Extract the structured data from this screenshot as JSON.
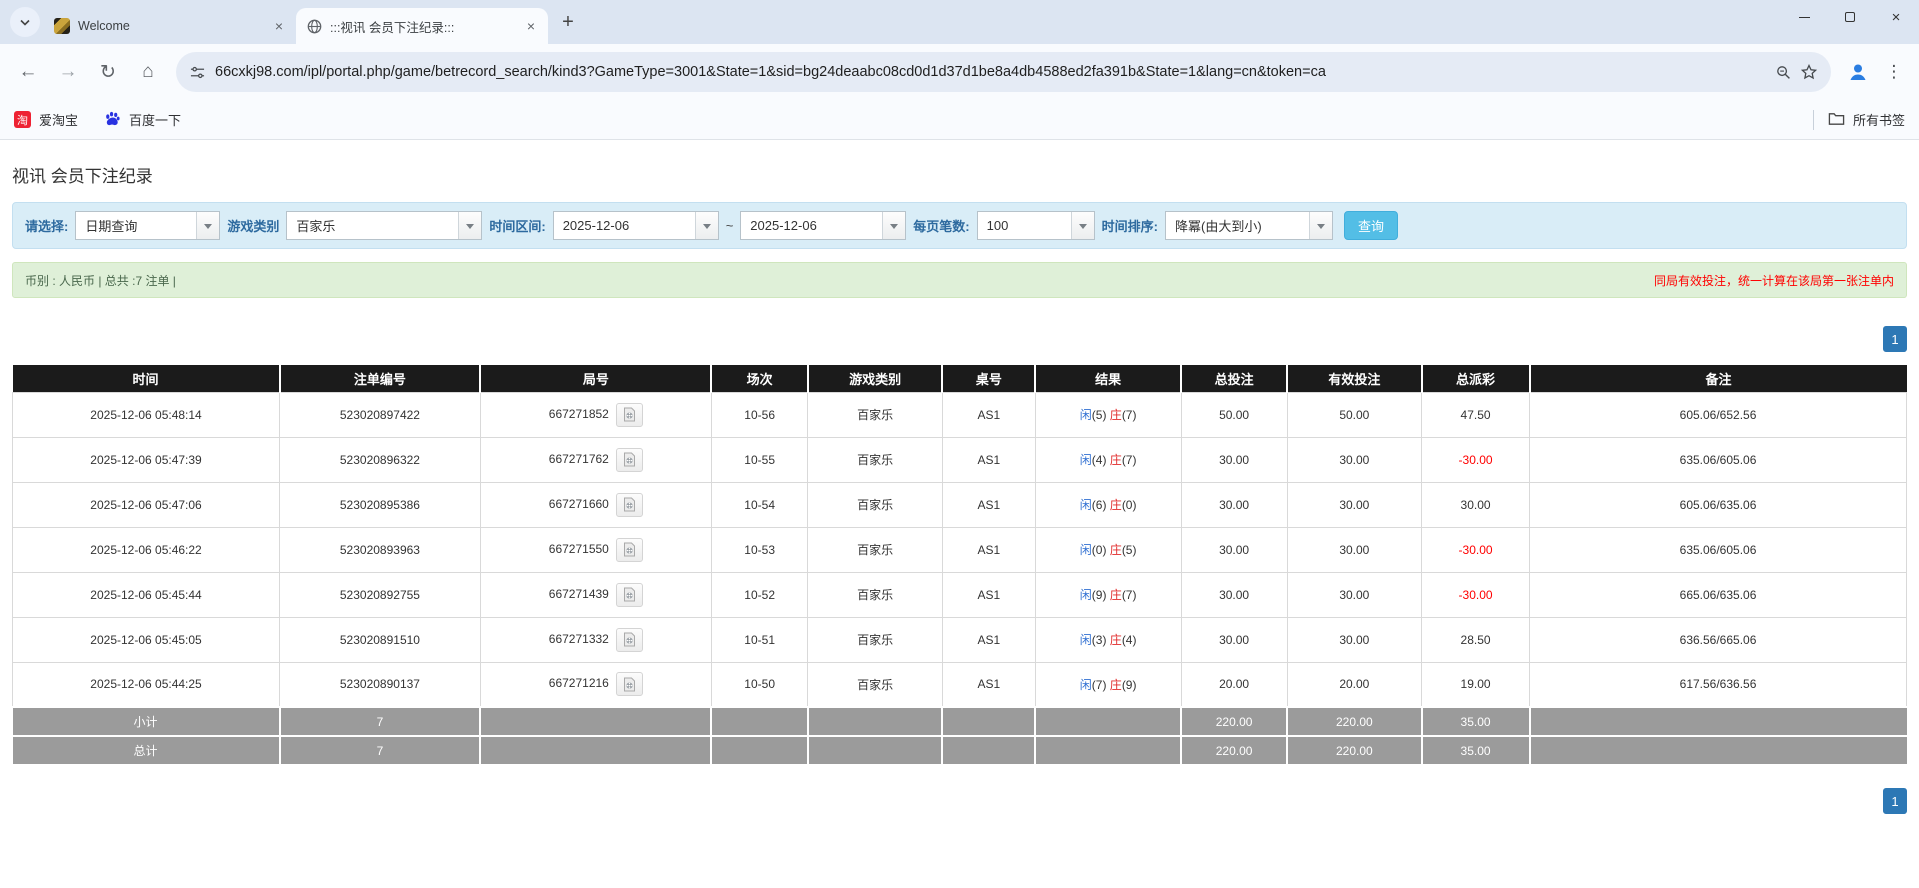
{
  "browser": {
    "tabs": [
      {
        "title": "Welcome"
      },
      {
        "title": ":::视讯 会员下注纪录:::"
      }
    ],
    "url": "66cxkj98.com/ipl/portal.php/game/betrecord_search/kind3?GameType=3001&State=1&sid=bg24deaabc08cd0d1d37d1be8a4db4588ed2fa391b&State=1&lang=cn&token=ca",
    "bookmarks": {
      "taobao_label": "爱淘宝",
      "taobao_icon_char": "淘",
      "baidu_label": "百度一下",
      "all_bookmarks_label": "所有书签"
    }
  },
  "page": {
    "title": "视讯 会员下注纪录",
    "filters": {
      "select_label": "请选择:",
      "select_value": "日期查询",
      "game_label": "游戏类别",
      "game_value": "百家乐",
      "range_label": "时间区间:",
      "date_from": "2025-12-06",
      "range_separator": "~",
      "date_to": "2025-12-06",
      "per_page_label": "每页笔数:",
      "per_page_value": "100",
      "sort_label": "时间排序:",
      "sort_value": "降冪(由大到小)",
      "search_button": "查询"
    },
    "summary_bar": {
      "left": "币别 : 人民币 | 总共 :7 注单 |",
      "right_note": "同局有效投注，统一计算在该局第一张注单内"
    },
    "pagination": {
      "current_page": "1"
    }
  },
  "table": {
    "headers": [
      "时间",
      "注单编号",
      "局号",
      "场次",
      "游戏类别",
      "桌号",
      "结果",
      "总投注",
      "有效投注",
      "总派彩",
      "备注"
    ],
    "rows": [
      {
        "time": "2025-12-06 05:48:14",
        "bet_no": "523020897422",
        "round_no": "667271852",
        "session": "10-56",
        "game": "百家乐",
        "table_no": "AS1",
        "player": "闲",
        "player_score": "(5)",
        "banker": "庄",
        "banker_score": "(7)",
        "total_bet": "50.00",
        "valid_bet": "50.00",
        "payout": "47.50",
        "remark": "605.06/652.56"
      },
      {
        "time": "2025-12-06 05:47:39",
        "bet_no": "523020896322",
        "round_no": "667271762",
        "session": "10-55",
        "game": "百家乐",
        "table_no": "AS1",
        "player": "闲",
        "player_score": "(4)",
        "banker": "庄",
        "banker_score": "(7)",
        "total_bet": "30.00",
        "valid_bet": "30.00",
        "payout": "-30.00",
        "remark": "635.06/605.06"
      },
      {
        "time": "2025-12-06 05:47:06",
        "bet_no": "523020895386",
        "round_no": "667271660",
        "session": "10-54",
        "game": "百家乐",
        "table_no": "AS1",
        "player": "闲",
        "player_score": "(6)",
        "banker": "庄",
        "banker_score": "(0)",
        "total_bet": "30.00",
        "valid_bet": "30.00",
        "payout": "30.00",
        "remark": "605.06/635.06"
      },
      {
        "time": "2025-12-06 05:46:22",
        "bet_no": "523020893963",
        "round_no": "667271550",
        "session": "10-53",
        "game": "百家乐",
        "table_no": "AS1",
        "player": "闲",
        "player_score": "(0)",
        "banker": "庄",
        "banker_score": "(5)",
        "total_bet": "30.00",
        "valid_bet": "30.00",
        "payout": "-30.00",
        "remark": "635.06/605.06"
      },
      {
        "time": "2025-12-06 05:45:44",
        "bet_no": "523020892755",
        "round_no": "667271439",
        "session": "10-52",
        "game": "百家乐",
        "table_no": "AS1",
        "player": "闲",
        "player_score": "(9)",
        "banker": "庄",
        "banker_score": "(7)",
        "total_bet": "30.00",
        "valid_bet": "30.00",
        "payout": "-30.00",
        "remark": "665.06/635.06"
      },
      {
        "time": "2025-12-06 05:45:05",
        "bet_no": "523020891510",
        "round_no": "667271332",
        "session": "10-51",
        "game": "百家乐",
        "table_no": "AS1",
        "player": "闲",
        "player_score": "(3)",
        "banker": "庄",
        "banker_score": "(4)",
        "total_bet": "30.00",
        "valid_bet": "30.00",
        "payout": "28.50",
        "remark": "636.56/665.06"
      },
      {
        "time": "2025-12-06 05:44:25",
        "bet_no": "523020890137",
        "round_no": "667271216",
        "session": "10-50",
        "game": "百家乐",
        "table_no": "AS1",
        "player": "闲",
        "player_score": "(7)",
        "banker": "庄",
        "banker_score": "(9)",
        "total_bet": "20.00",
        "valid_bet": "20.00",
        "payout": "19.00",
        "remark": "617.56/636.56"
      }
    ],
    "subtotal": {
      "label": "小计",
      "count": "7",
      "total_bet": "220.00",
      "valid_bet": "220.00",
      "payout": "35.00"
    },
    "grand_total": {
      "label": "总计",
      "count": "7",
      "total_bet": "220.00",
      "valid_bet": "220.00",
      "payout": "35.00"
    }
  },
  "colors": {
    "header_bg": "#1b1b1b",
    "footer_gray": "#9b9b9b",
    "link_blue": "#2f6fd2",
    "banker_red": "#e02b2b",
    "negative_red": "#ff0000",
    "filter_bg": "#d9edf7",
    "summary_bg": "#dff0d8",
    "search_button_blue": "#53bee6",
    "pagination_blue": "#2d78b5"
  }
}
